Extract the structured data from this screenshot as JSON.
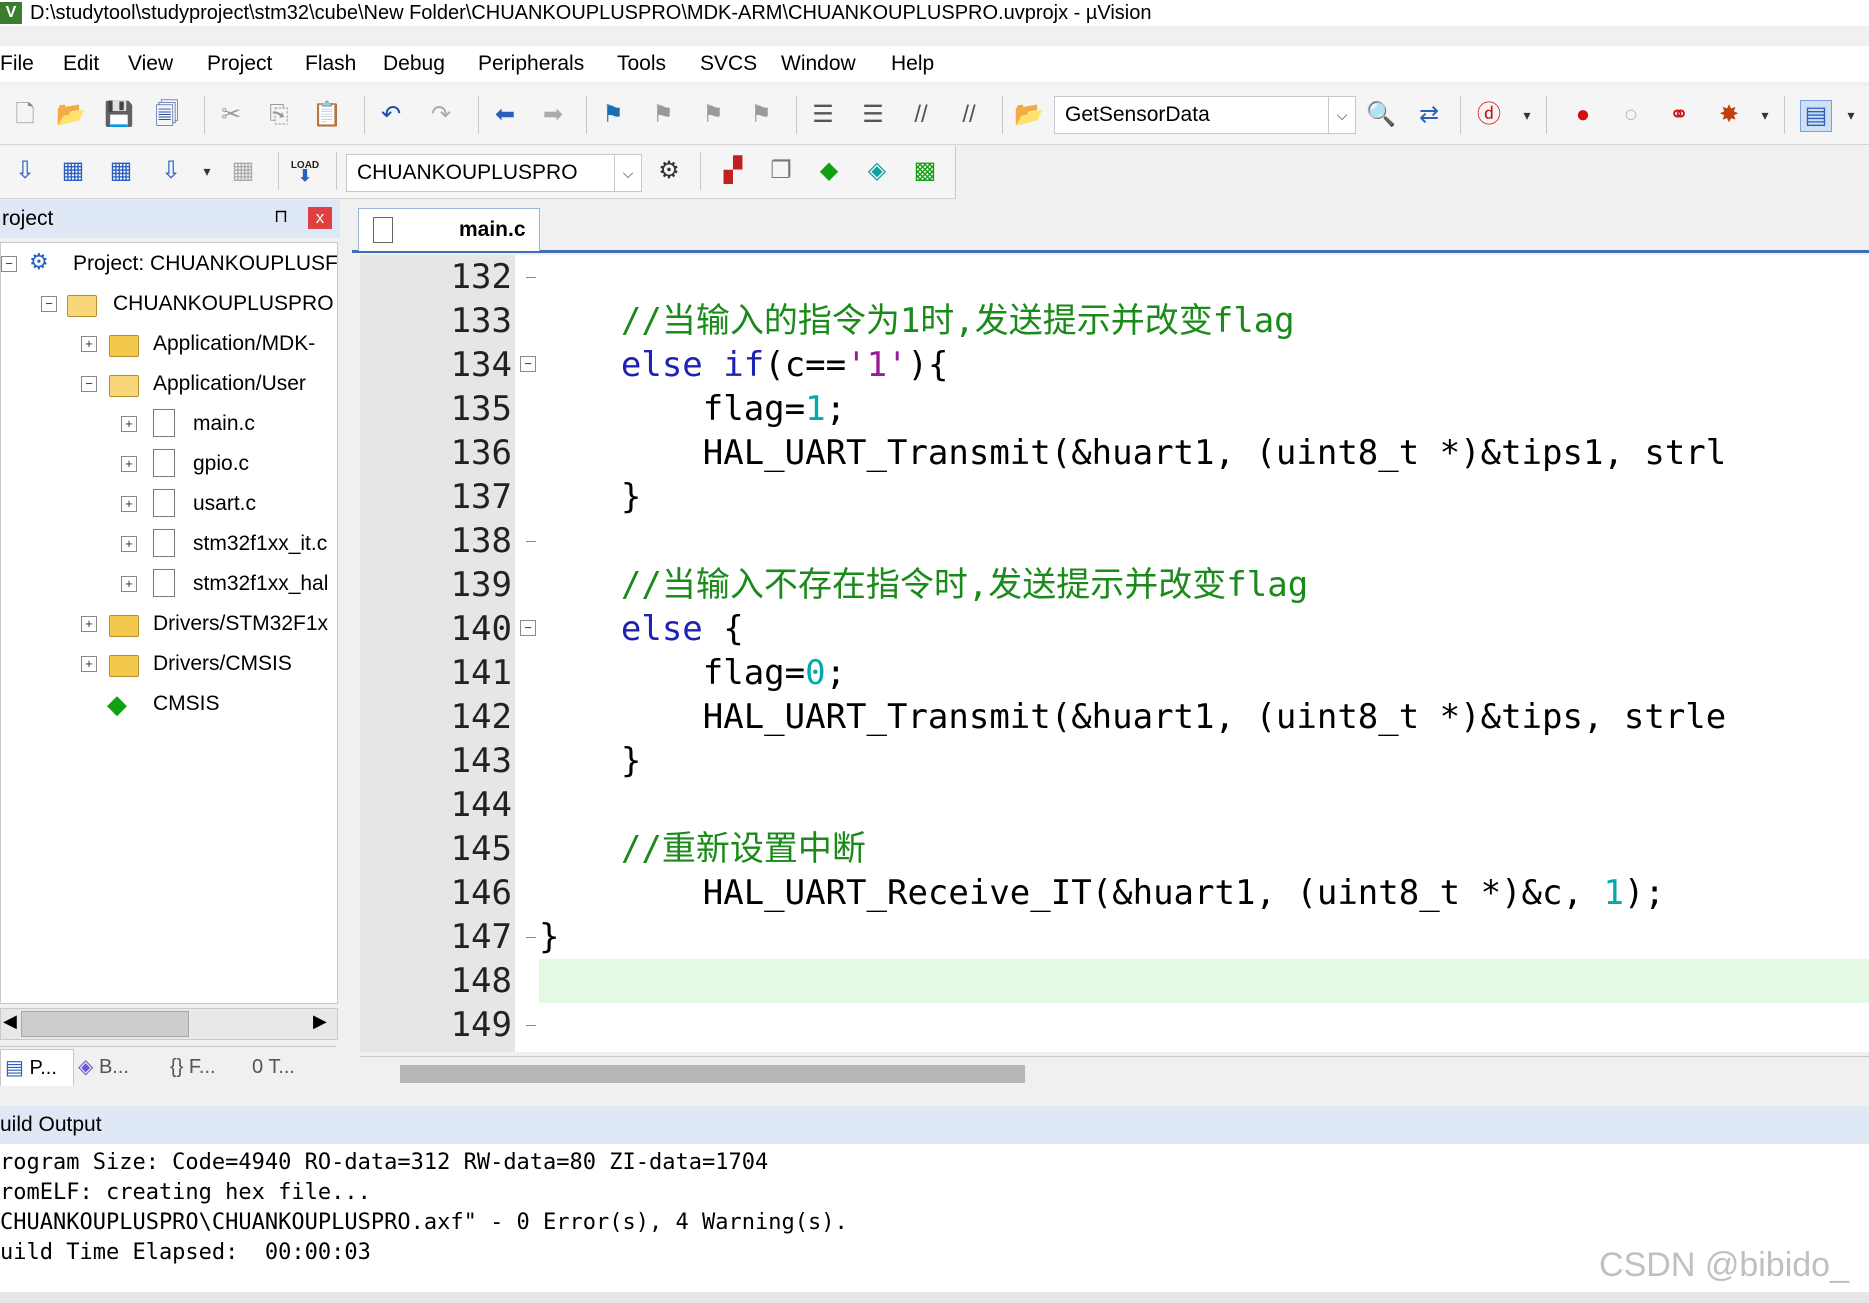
{
  "window": {
    "title": "D:\\studytool\\studyproject\\stm32\\cube\\New Folder\\CHUANKOUPLUSPRO\\MDK-ARM\\CHUANKOUPLUSPRO.uvprojx - µVision"
  },
  "menu": [
    "File",
    "Edit",
    "View",
    "Project",
    "Flash",
    "Debug",
    "Peripherals",
    "Tools",
    "SVCS",
    "Window",
    "Help"
  ],
  "toolbar": {
    "find_combo": "GetSensorData",
    "target_combo": "CHUANKOUPLUSPRO",
    "load_label": "LOAD"
  },
  "project_panel": {
    "title": "roject",
    "pin": "⊓",
    "close": "x",
    "tree": [
      {
        "label": "Project: CHUANKOUPLUSF"
      },
      {
        "label": "CHUANKOUPLUSPRO"
      },
      {
        "label": "Application/MDK-"
      },
      {
        "label": "Application/User"
      },
      {
        "label": "main.c"
      },
      {
        "label": "gpio.c"
      },
      {
        "label": "usart.c"
      },
      {
        "label": "stm32f1xx_it.c"
      },
      {
        "label": "stm32f1xx_hal"
      },
      {
        "label": "Drivers/STM32F1x"
      },
      {
        "label": "Drivers/CMSIS"
      },
      {
        "label": "CMSIS"
      }
    ],
    "tabs": [
      "P...",
      "B...",
      "{} F...",
      "0 T..."
    ]
  },
  "editor": {
    "tab": "main.c",
    "line_numbers": [
      "132",
      "133",
      "134",
      "135",
      "136",
      "137",
      "138",
      "139",
      "140",
      "141",
      "142",
      "143",
      "144",
      "145",
      "146",
      "147",
      "148",
      "149"
    ],
    "lines": [
      "",
      "    //当输入的指令为1时,发送提示并改变flag",
      "    else if(c=='1'){",
      "        flag=1;",
      "        HAL_UART_Transmit(&huart1, (uint8_t *)&tips1, strl",
      "    }",
      "",
      "    //当输入不存在指令时,发送提示并改变flag",
      "    else {",
      "        flag=0;",
      "        HAL_UART_Transmit(&huart1, (uint8_t *)&tips, strle",
      "    }",
      "",
      "    //重新设置中断",
      "        HAL_UART_Receive_IT(&huart1, (uint8_t *)&c, 1);",
      "}",
      "",
      ""
    ]
  },
  "build_output": {
    "title": "uild Output",
    "lines": [
      "rogram Size: Code=4940 RO-data=312 RW-data=80 ZI-data=1704",
      "romELF: creating hex file...",
      "CHUANKOUPLUSPRO\\CHUANKOUPLUSPRO.axf\" - 0 Error(s), 4 Warning(s).",
      "uild Time Elapsed:  00:00:03"
    ]
  },
  "watermark": "CSDN @bibido_"
}
